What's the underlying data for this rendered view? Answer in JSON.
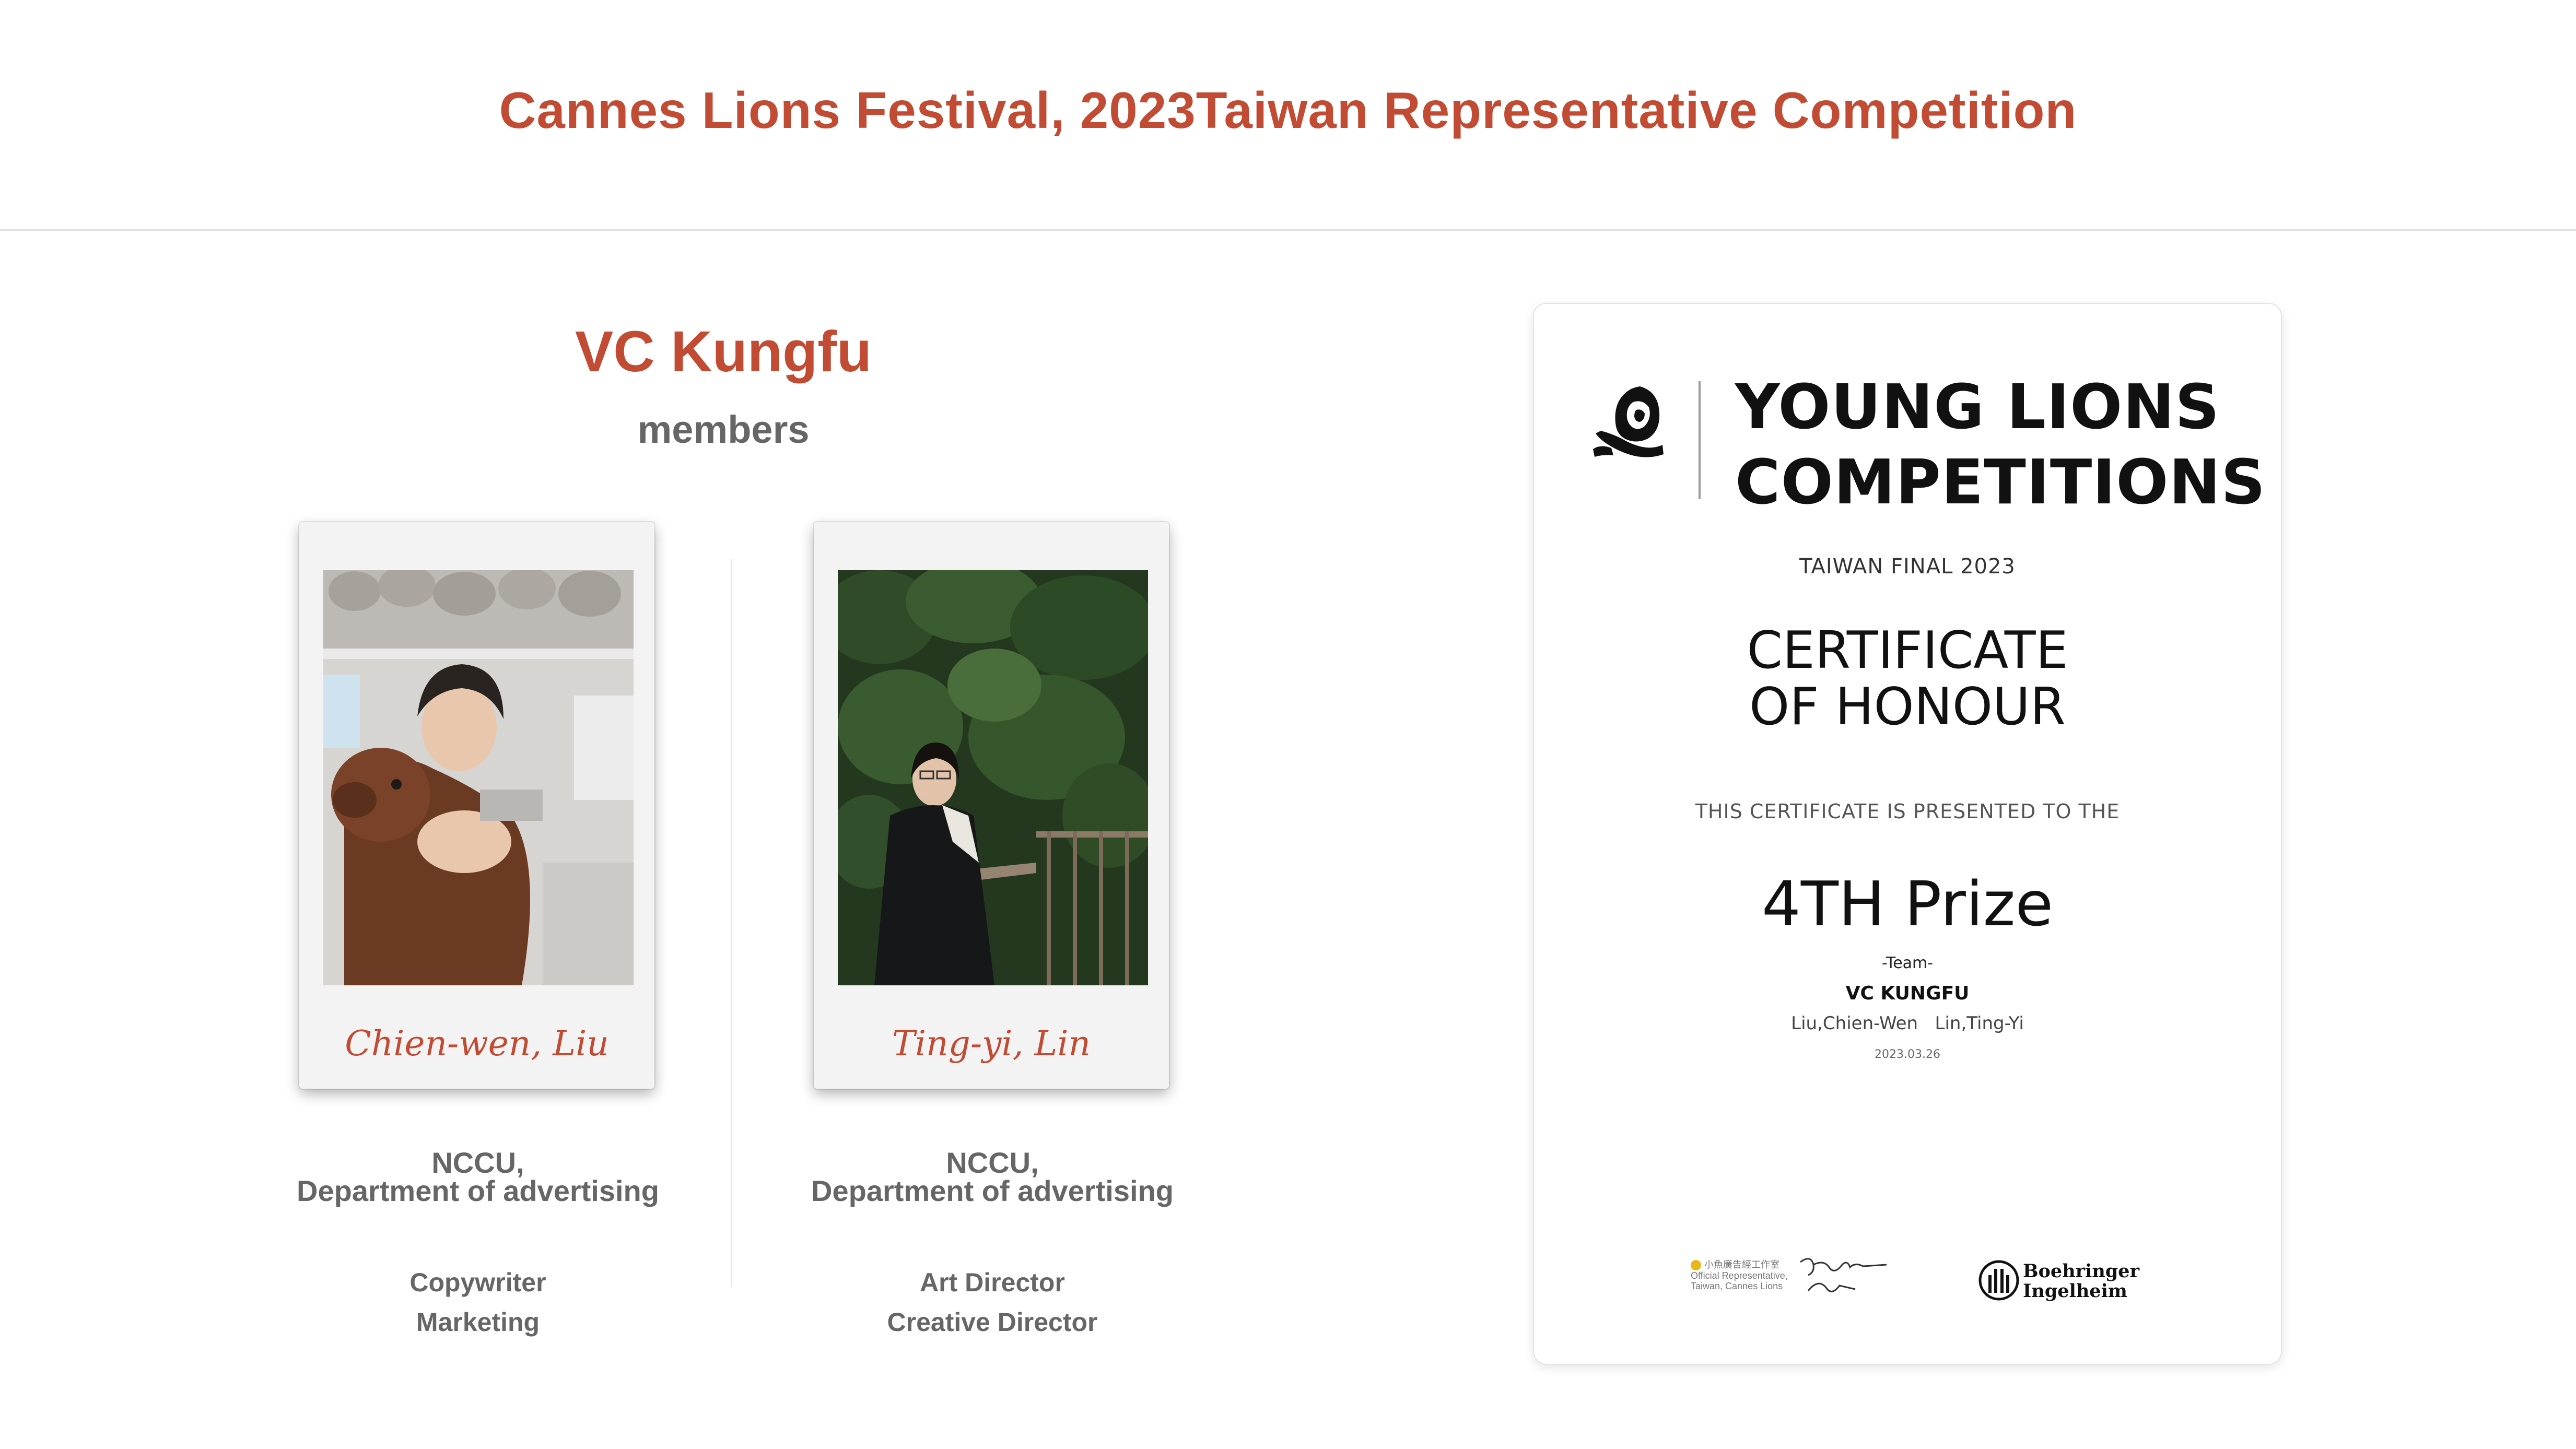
{
  "header": {
    "title": "Cannes Lions Festival, 2023Taiwan Representative Competition"
  },
  "team": {
    "name": "VC Kungfu",
    "subtitle": "members"
  },
  "members": [
    {
      "caption": "Chien-wen, Liu",
      "school_line1": "NCCU,",
      "school_line2": "Department of advertising",
      "role1": "Copywriter",
      "role2": "Marketing"
    },
    {
      "caption": "Ting-yi, Lin",
      "school_line1": "NCCU,",
      "school_line2": "Department of advertising",
      "role1": "Art Director",
      "role2": "Creative Director"
    }
  ],
  "certificate": {
    "heading_line1": "YOUNG LIONS",
    "heading_line2": "COMPETITIONS",
    "subheading": "TAIWAN FINAL 2023",
    "title_line1": "CERTIFICATE",
    "title_line2": "OF HONOUR",
    "presented": "THIS CERTIFICATE IS PRESENTED TO THE",
    "prize": "4TH Prize",
    "team_label": "-Team-",
    "team_name": "VC KUNGFU",
    "members": "Liu,Chien-Wen   Lin,Ting-Yi",
    "date": "2023.03.26",
    "sponsor_line1": "小魚廣告經工作室",
    "sponsor_line2": "Official Representative,",
    "sponsor_line3": "Taiwan, Cannes Lions",
    "bi_line1": "Boehringer",
    "bi_line2": "Ingelheim",
    "logo_icon": "lion-logo-icon",
    "bi_icon": "boehringer-logo-icon"
  },
  "colors": {
    "accent": "#c14b33",
    "muted_text": "#666666",
    "divider": "#e2e2e2"
  }
}
